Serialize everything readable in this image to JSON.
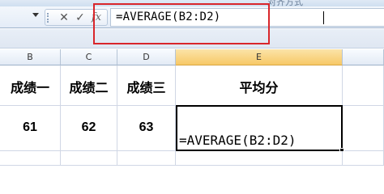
{
  "ribbon": {
    "partial_label": "对齐方式"
  },
  "formula_bar": {
    "cancel_icon": "x-icon",
    "enter_icon": "check-icon",
    "fx_label": "fx",
    "formula": "=AVERAGE(B2:D2)"
  },
  "columns": [
    "B",
    "C",
    "D",
    "E"
  ],
  "active_column": "E",
  "rows": {
    "header": [
      "成绩一",
      "成绩二",
      "成绩三",
      "平均分"
    ],
    "values": [
      "61",
      "62",
      "63"
    ],
    "active_cell_text": "=AVERAGE(B2:D2)"
  },
  "colors": {
    "highlight": "#d9262b",
    "active_header": "#f7c967"
  }
}
